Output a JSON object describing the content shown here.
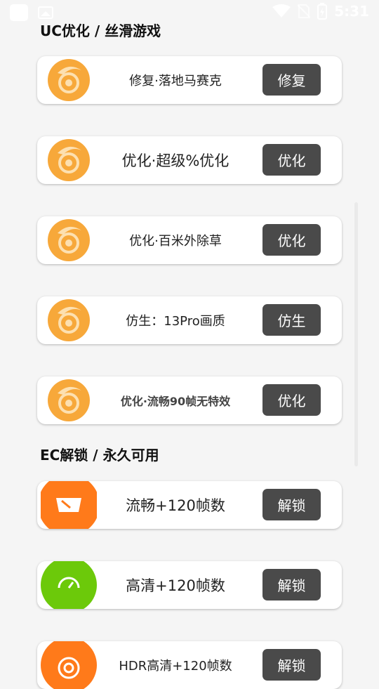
{
  "status_bar": {
    "time": "5:31"
  },
  "sections": [
    {
      "title": "UC优化 / 丝滑游戏"
    },
    {
      "title": "EC解锁 / 永久可用"
    }
  ],
  "cards": [
    {
      "label": "修复·落地马赛克",
      "button": "修复"
    },
    {
      "label": "优化·超级%优化",
      "button": "优化"
    },
    {
      "label": "优化·百米外除草",
      "button": "优化"
    },
    {
      "label": "仿生：13Pro画质",
      "button": "仿生"
    },
    {
      "label": "优化·流畅90帧无特效",
      "button": "优化"
    },
    {
      "label": "流畅+120帧数",
      "button": "解锁",
      "icon": "speedometer-icon",
      "icon_color": "#ff7a1a"
    },
    {
      "label": "高清+120帧数",
      "button": "解锁",
      "icon": "gauge-icon",
      "icon_color": "#6cc90a"
    },
    {
      "label": "HDR高清+120帧数",
      "button": "解锁",
      "icon": "speedometer-icon",
      "icon_color": "#ff7a1a"
    }
  ],
  "colors": {
    "button_bg": "#4a4a4a",
    "logo_orange": "#f5a623"
  }
}
